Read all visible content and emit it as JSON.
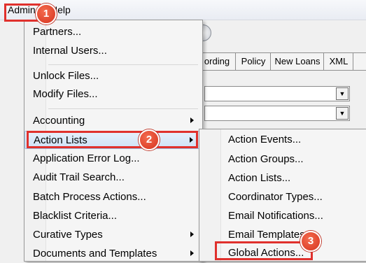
{
  "menubar": {
    "admin": "Admin",
    "help": "Help"
  },
  "tabs": [
    "ording",
    "Policy",
    "New Loans",
    "XML"
  ],
  "admin_menu": {
    "items": [
      {
        "label": "Partners..."
      },
      {
        "label": "Internal Users..."
      },
      {
        "label": "Unlock Files..."
      },
      {
        "label": "Modify Files..."
      },
      {
        "label": "Accounting",
        "submenu": true
      },
      {
        "label": "Action Lists",
        "submenu": true,
        "highlighted": true
      },
      {
        "label": "Application Error Log..."
      },
      {
        "label": "Audit Trail Search..."
      },
      {
        "label": "Batch Process Actions..."
      },
      {
        "label": "Blacklist Criteria..."
      },
      {
        "label": "Curative Types",
        "submenu": true
      },
      {
        "label": "Documents and Templates",
        "submenu": true
      }
    ]
  },
  "action_lists_submenu": {
    "items": [
      {
        "label": "Action Events..."
      },
      {
        "label": "Action Groups..."
      },
      {
        "label": "Action Lists..."
      },
      {
        "label": "Coordinator Types..."
      },
      {
        "label": "Email Notifications..."
      },
      {
        "label": "Email Templates"
      },
      {
        "label": "Global Actions..."
      }
    ]
  },
  "callouts": [
    "1",
    "2",
    "3"
  ],
  "colors": {
    "callout": "#d6331f",
    "highlight_box": "#e0312d",
    "menu_hover": "#cfe2f7"
  }
}
